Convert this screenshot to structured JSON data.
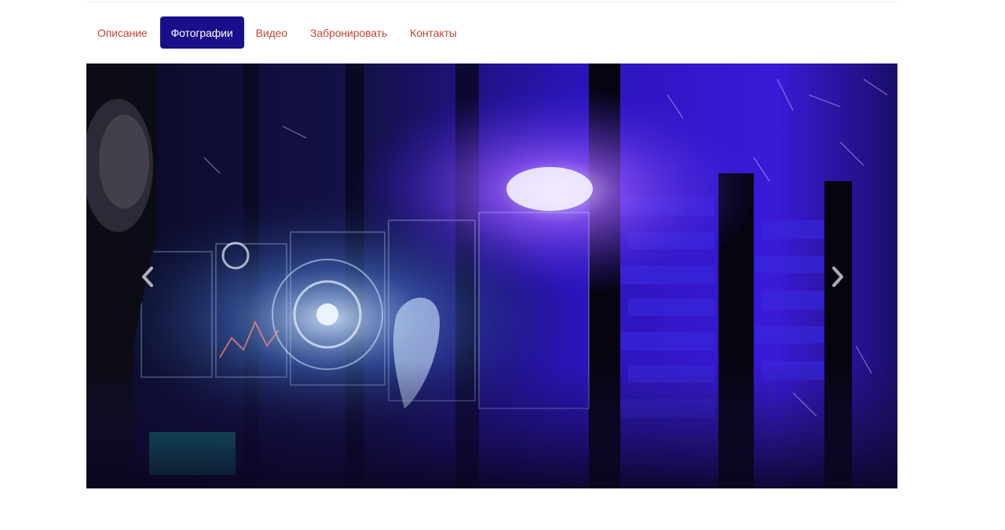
{
  "tabs": [
    {
      "label": "Описание",
      "active": false
    },
    {
      "label": "Фотографии",
      "active": true
    },
    {
      "label": "Видео",
      "active": false
    },
    {
      "label": "Забронировать",
      "active": false
    },
    {
      "label": "Контакты",
      "active": false
    }
  ],
  "carousel": {
    "prev_icon": "chevron-left-icon",
    "next_icon": "chevron-right-icon",
    "scene_description_icon": "photo-icon"
  },
  "colors": {
    "tab_text": "#c0473a",
    "tab_active_bg": "#1a0f8a",
    "tab_active_text": "#ffffff"
  }
}
